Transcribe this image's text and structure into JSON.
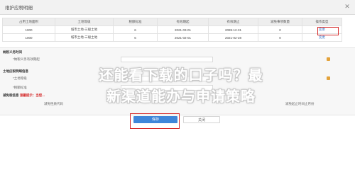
{
  "dialog": {
    "title": "维护应税明细",
    "close_label": "✕"
  },
  "table": {
    "headers": [
      "占用土地面积",
      "土地等级",
      "税额标准",
      "有效期起",
      "有效期止",
      "减免事项数量",
      "操作类型"
    ],
    "rows": [
      [
        "1000",
        "城市土地-三级土地",
        "6",
        "2021-03-01",
        "2099-12-31",
        "0",
        "变更"
      ],
      [
        "1000",
        "城市土地-三级土地",
        "6",
        "2021-02-01",
        "2021-02-28",
        "0",
        "变更"
      ]
    ]
  },
  "form": {
    "tax_period_section": "纳税义务时间",
    "tax_period_label": "*纳税义务有效期起",
    "land_info_section": "土地应税明细信息",
    "land_grade_label": "*土地等级",
    "tax_std_label": "*税额标准",
    "exempt_section": "减免税信息",
    "exempt_note": "温馨提示：当您...",
    "exempt_nature_label": "减免性质代码",
    "exempt_end_label": "减免起止时间止月份"
  },
  "overlay": {
    "line1": "还能看下载的口子吗？最",
    "line2": "新渠道能办与申请策略"
  },
  "buttons": {
    "save": "保存",
    "close": "关闭"
  },
  "colors": {
    "primary": "#3f86d9",
    "highlight": "#d62b2b",
    "link": "#3a78c9"
  }
}
